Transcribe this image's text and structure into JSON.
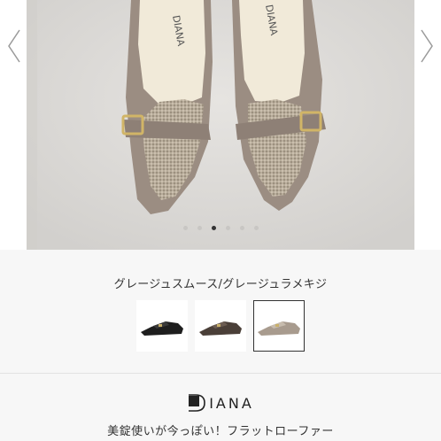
{
  "carousel": {
    "slides_count": 6,
    "active_index": 2,
    "prev_icon": "chevron-left-icon",
    "next_icon": "chevron-right-icon",
    "insole_text": "DIANA"
  },
  "variant": {
    "selected_color_name": "グレージュスムース/グレージュラメキジ",
    "swatches": [
      {
        "color": "#1e1e1e",
        "selected": false
      },
      {
        "color": "#4a3f38",
        "selected": false
      },
      {
        "color": "#a89b8e",
        "selected": true
      }
    ]
  },
  "brand": {
    "name": "IANA",
    "logo_icon": "d-logo-icon"
  },
  "product": {
    "title": "美錠使いが今っぽい！フラットローファー"
  },
  "colors": {
    "shoe_leather": "#9b8d82",
    "tweed": "#b7ab98",
    "buckle": "#d1b567",
    "background": "#dedcd9"
  }
}
